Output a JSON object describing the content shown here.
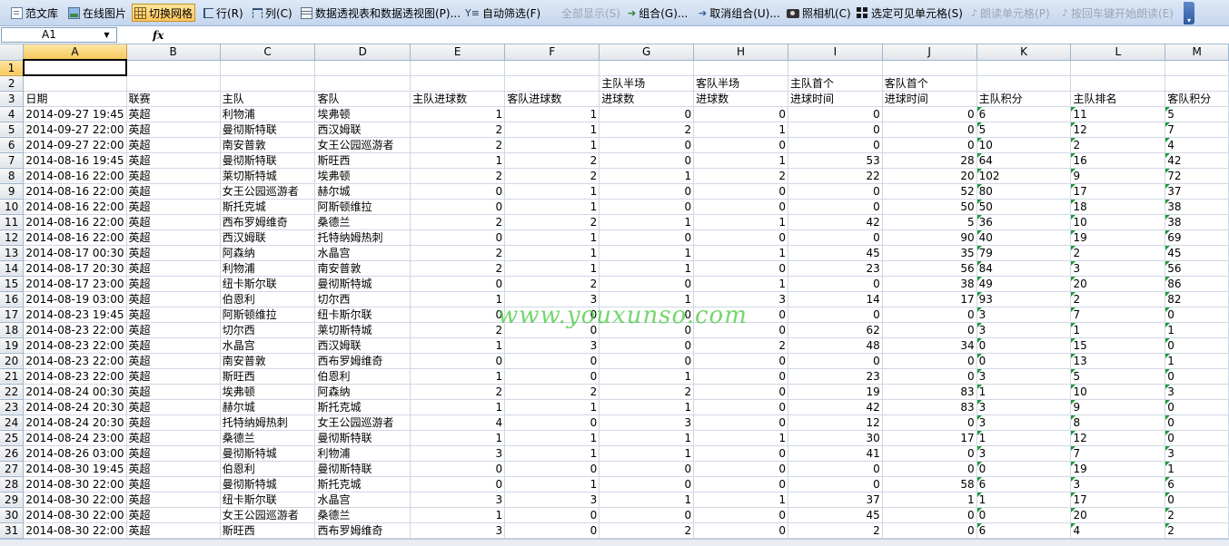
{
  "toolbar": {
    "items": [
      {
        "label": "范文库",
        "icon": "document-icon"
      },
      {
        "label": "在线图片",
        "icon": "picture-icon"
      },
      {
        "label": "切换网格",
        "icon": "grid-icon",
        "active": true
      },
      {
        "label": "行(R)",
        "icon": "row-icon"
      },
      {
        "label": "列(C)",
        "icon": "column-icon"
      },
      {
        "label": "数据透视表和数据透视图(P)...",
        "icon": "pivot-table-icon"
      },
      {
        "label": "自动筛选(F)",
        "icon": "filter-icon"
      },
      {
        "label": "全部显示(S)",
        "icon": "",
        "disabled": true
      },
      {
        "label": "组合(G)...",
        "icon": "group-arrow-icon"
      },
      {
        "label": "取消组合(U)...",
        "icon": "ungroup-arrow-icon"
      },
      {
        "label": "照相机(C)",
        "icon": "camera-icon"
      },
      {
        "label": "选定可见单元格(S)",
        "icon": "visible-cells-icon"
      },
      {
        "label": "朗读单元格(P)",
        "icon": "speak-icon",
        "disabled": true
      },
      {
        "label": "按回车键开始朗读(E)",
        "icon": "speak-enter-icon",
        "disabled": true
      }
    ]
  },
  "formula_bar": {
    "name_box": "A1",
    "fx": "fx",
    "formula": ""
  },
  "columns": [
    "A",
    "B",
    "C",
    "D",
    "E",
    "F",
    "G",
    "H",
    "I",
    "J",
    "K",
    "L",
    "M"
  ],
  "header_rows": {
    "row2": [
      "",
      "",
      "",
      "",
      "",
      "",
      "主队半场",
      "客队半场",
      "主队首个",
      "客队首个",
      "",
      "",
      ""
    ],
    "row3": [
      "日期",
      "联赛",
      "主队",
      "客队",
      "主队进球数",
      "客队进球数",
      "进球数",
      "进球数",
      "进球时间",
      "进球时间",
      "主队积分",
      "主队排名",
      "客队积分"
    ]
  },
  "rows": [
    [
      "2014-09-27 19:45",
      "英超",
      "利物浦",
      "埃弗顿",
      "1",
      "1",
      "0",
      "0",
      "0",
      "0",
      "6",
      "11",
      "5"
    ],
    [
      "2014-09-27 22:00",
      "英超",
      "曼彻斯特联",
      "西汉姆联",
      "2",
      "1",
      "2",
      "1",
      "0",
      "0",
      "5",
      "12",
      "7"
    ],
    [
      "2014-09-27 22:00",
      "英超",
      "南安普敦",
      "女王公园巡游者",
      "2",
      "1",
      "0",
      "0",
      "0",
      "0",
      "10",
      "2",
      "4"
    ],
    [
      "2014-08-16 19:45",
      "英超",
      "曼彻斯特联",
      "斯旺西",
      "1",
      "2",
      "0",
      "1",
      "53",
      "28",
      "64",
      "16",
      "42"
    ],
    [
      "2014-08-16 22:00",
      "英超",
      "莱切斯特城",
      "埃弗顿",
      "2",
      "2",
      "1",
      "2",
      "22",
      "20",
      "102",
      "9",
      "72"
    ],
    [
      "2014-08-16 22:00",
      "英超",
      "女王公园巡游者",
      "赫尔城",
      "0",
      "1",
      "0",
      "0",
      "0",
      "52",
      "80",
      "17",
      "37"
    ],
    [
      "2014-08-16 22:00",
      "英超",
      "斯托克城",
      "阿斯顿维拉",
      "0",
      "1",
      "0",
      "0",
      "0",
      "50",
      "50",
      "18",
      "38"
    ],
    [
      "2014-08-16 22:00",
      "英超",
      "西布罗姆维奇",
      "桑德兰",
      "2",
      "2",
      "1",
      "1",
      "42",
      "5",
      "36",
      "10",
      "38"
    ],
    [
      "2014-08-16 22:00",
      "英超",
      "西汉姆联",
      "托特纳姆热刺",
      "0",
      "1",
      "0",
      "0",
      "0",
      "90",
      "40",
      "19",
      "69"
    ],
    [
      "2014-08-17 00:30",
      "英超",
      "阿森纳",
      "水晶宫",
      "2",
      "1",
      "1",
      "1",
      "45",
      "35",
      "79",
      "2",
      "45"
    ],
    [
      "2014-08-17 20:30",
      "英超",
      "利物浦",
      "南安普敦",
      "2",
      "1",
      "1",
      "0",
      "23",
      "56",
      "84",
      "3",
      "56"
    ],
    [
      "2014-08-17 23:00",
      "英超",
      "纽卡斯尔联",
      "曼彻斯特城",
      "0",
      "2",
      "0",
      "1",
      "0",
      "38",
      "49",
      "20",
      "86"
    ],
    [
      "2014-08-19 03:00",
      "英超",
      "伯恩利",
      "切尔西",
      "1",
      "3",
      "1",
      "3",
      "14",
      "17",
      "93",
      "2",
      "82"
    ],
    [
      "2014-08-23 19:45",
      "英超",
      "阿斯顿维拉",
      "纽卡斯尔联",
      "0",
      "0",
      "0",
      "0",
      "0",
      "0",
      "3",
      "7",
      "0"
    ],
    [
      "2014-08-23 22:00",
      "英超",
      "切尔西",
      "莱切斯特城",
      "2",
      "0",
      "0",
      "0",
      "62",
      "0",
      "3",
      "1",
      "1"
    ],
    [
      "2014-08-23 22:00",
      "英超",
      "水晶宫",
      "西汉姆联",
      "1",
      "3",
      "0",
      "2",
      "48",
      "34",
      "0",
      "15",
      "0"
    ],
    [
      "2014-08-23 22:00",
      "英超",
      "南安普敦",
      "西布罗姆维奇",
      "0",
      "0",
      "0",
      "0",
      "0",
      "0",
      "0",
      "13",
      "1"
    ],
    [
      "2014-08-23 22:00",
      "英超",
      "斯旺西",
      "伯恩利",
      "1",
      "0",
      "1",
      "0",
      "23",
      "0",
      "3",
      "5",
      "0"
    ],
    [
      "2014-08-24 00:30",
      "英超",
      "埃弗顿",
      "阿森纳",
      "2",
      "2",
      "2",
      "0",
      "19",
      "83",
      "1",
      "10",
      "3"
    ],
    [
      "2014-08-24 20:30",
      "英超",
      "赫尔城",
      "斯托克城",
      "1",
      "1",
      "1",
      "0",
      "42",
      "83",
      "3",
      "9",
      "0"
    ],
    [
      "2014-08-24 20:30",
      "英超",
      "托特纳姆热刺",
      "女王公园巡游者",
      "4",
      "0",
      "3",
      "0",
      "12",
      "0",
      "3",
      "8",
      "0"
    ],
    [
      "2014-08-24 23:00",
      "英超",
      "桑德兰",
      "曼彻斯特联",
      "1",
      "1",
      "1",
      "1",
      "30",
      "17",
      "1",
      "12",
      "0"
    ],
    [
      "2014-08-26 03:00",
      "英超",
      "曼彻斯特城",
      "利物浦",
      "3",
      "1",
      "1",
      "0",
      "41",
      "0",
      "3",
      "7",
      "3"
    ],
    [
      "2014-08-30 19:45",
      "英超",
      "伯恩利",
      "曼彻斯特联",
      "0",
      "0",
      "0",
      "0",
      "0",
      "0",
      "0",
      "19",
      "1"
    ],
    [
      "2014-08-30 22:00",
      "英超",
      "曼彻斯特城",
      "斯托克城",
      "0",
      "1",
      "0",
      "0",
      "0",
      "58",
      "6",
      "3",
      "6"
    ],
    [
      "2014-08-30 22:00",
      "英超",
      "纽卡斯尔联",
      "水晶宫",
      "3",
      "3",
      "1",
      "1",
      "37",
      "1",
      "1",
      "17",
      "0"
    ],
    [
      "2014-08-30 22:00",
      "英超",
      "女王公园巡游者",
      "桑德兰",
      "1",
      "0",
      "0",
      "0",
      "45",
      "0",
      "0",
      "20",
      "2"
    ],
    [
      "2014-08-30 22:00",
      "英超",
      "斯旺西",
      "西布罗姆维奇",
      "3",
      "0",
      "2",
      "0",
      "2",
      "0",
      "6",
      "4",
      "2"
    ]
  ],
  "watermark": "www.youxunso.com",
  "colors": {
    "accent": "#ffc55a",
    "grid_line": "#d0d7e5",
    "flag": "#1e9a38",
    "watermark": "#46c83c"
  }
}
